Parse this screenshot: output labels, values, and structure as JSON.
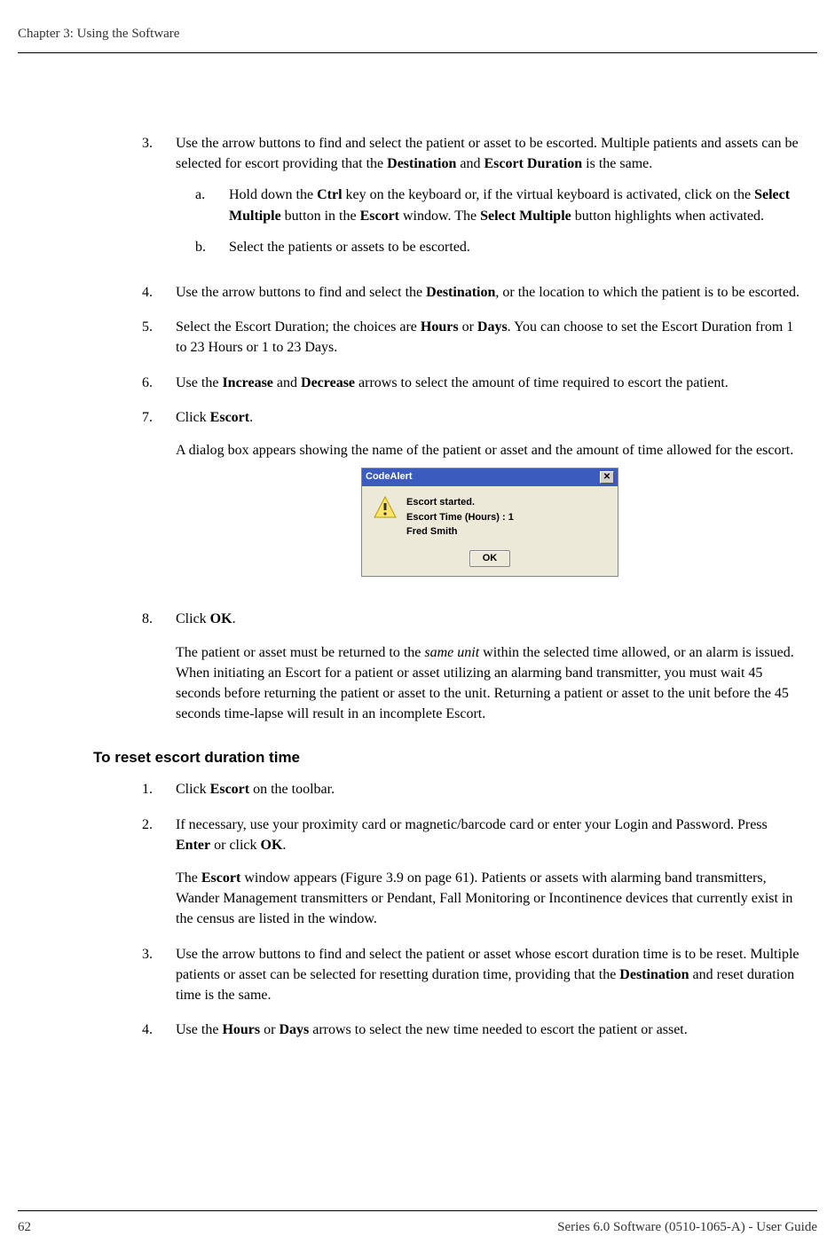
{
  "header": {
    "chapter": "Chapter 3: Using the Software"
  },
  "steps": {
    "s3": {
      "num": "3.",
      "text_parts": [
        "Use the arrow buttons to find and select the patient or asset to be escorted. Multiple patients and assets can be selected for escort providing that the ",
        "Destination",
        " and ",
        "Escort Duration",
        " is the same."
      ],
      "a": {
        "num": "a.",
        "parts": [
          "Hold down the ",
          "Ctrl",
          " key on the keyboard or, if the virtual keyboard is activated, click on the ",
          "Select Multiple",
          " button in the ",
          "Escort",
          " window. The ",
          "Select Multiple",
          " button highlights when activated."
        ]
      },
      "b": {
        "num": "b.",
        "text": "Select the patients or assets to be escorted."
      }
    },
    "s4": {
      "num": "4.",
      "parts": [
        "Use the arrow buttons to find and select the ",
        "Destination",
        ", or the location to which the patient is to be escorted."
      ]
    },
    "s5": {
      "num": "5.",
      "parts": [
        "Select the Escort Duration; the choices are ",
        "Hours",
        " or ",
        "Days",
        ". You can choose to set the Escort Duration from 1 to 23 Hours or 1 to 23 Days."
      ]
    },
    "s6": {
      "num": "6.",
      "parts": [
        "Use the ",
        "Increase",
        " and ",
        "Decrease",
        " arrows to select the amount of time required to escort the patient."
      ]
    },
    "s7": {
      "num": "7.",
      "parts": [
        "Click ",
        "Escort",
        "."
      ],
      "follow": "A dialog box appears showing the name of the patient or asset and the amount of time allowed for the escort."
    },
    "s8": {
      "num": "8.",
      "parts": [
        "Click ",
        "OK",
        "."
      ],
      "follow_parts": [
        "The patient or asset must be returned to the ",
        "same unit",
        " within the selected time allowed, or an alarm is issued. When initiating an Escort for a patient or asset utilizing an alarming band transmitter, you must wait 45 seconds before returning the patient or asset to the unit. Returning a patient or asset to the unit before the 45 seconds time-lapse will result in an incomplete Escort."
      ]
    }
  },
  "dialog": {
    "title": "CodeAlert",
    "line1": "Escort started.",
    "line2": "Escort Time (Hours) : 1",
    "line3": "Fred Smith",
    "ok": "OK",
    "close": "✕"
  },
  "section2": {
    "heading": "To reset escort duration time",
    "r1": {
      "num": "1.",
      "parts": [
        "Click ",
        "Escort",
        " on the toolbar."
      ]
    },
    "r2": {
      "num": "2.",
      "parts": [
        "If necessary, use your proximity card or magnetic/barcode card or enter your Login and Password. Press ",
        "Enter",
        " or click ",
        "OK",
        "."
      ],
      "follow_parts": [
        "The ",
        "Escort",
        " window appears (Figure 3.9 on page 61). Patients or assets with alarming band transmitters, Wander Management transmitters or Pendant, Fall Monitoring or Incontinence devices that currently exist in the census are listed in the window."
      ]
    },
    "r3": {
      "num": "3.",
      "parts": [
        "Use the arrow buttons to find and select the patient or asset whose escort duration time is to be reset. Multiple patients or asset can be selected for resetting duration time, providing that the ",
        "Destination",
        " and reset duration time is the same."
      ]
    },
    "r4": {
      "num": "4.",
      "parts": [
        "Use the ",
        "Hours",
        " or ",
        "Days",
        " arrows to select the new time needed to escort the patient or asset."
      ]
    }
  },
  "footer": {
    "page": "62",
    "doc": "Series 6.0 Software (0510-1065-A) - User Guide"
  }
}
